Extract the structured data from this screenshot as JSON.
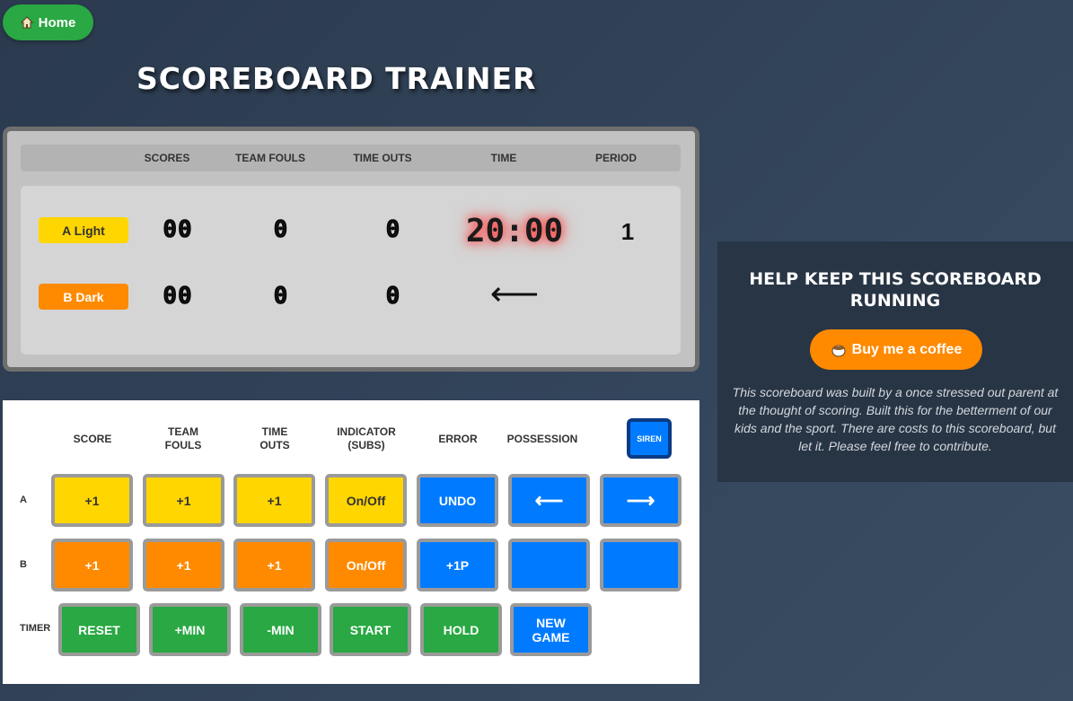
{
  "nav": {
    "home_label": "Home"
  },
  "title": "SCOREBOARD TRAINER",
  "scoreboard": {
    "headers": {
      "scores": "SCORES",
      "team_fouls": "TEAM FOULS",
      "time_outs": "TIME OUTS",
      "time": "TIME",
      "period": "PERIOD"
    },
    "team_a": {
      "name": "A Light",
      "score": "00",
      "fouls": "0",
      "timeouts": "0"
    },
    "team_b": {
      "name": "B Dark",
      "score": "00",
      "fouls": "0",
      "timeouts": "0"
    },
    "clock": "20:00",
    "period": "1",
    "possession_arrow": "⟵"
  },
  "controls": {
    "headers": {
      "score": "SCORE",
      "team_fouls": "TEAM\nFOULS",
      "time_outs": "TIME\nOUTS",
      "indicator": "INDICATOR\n(SUBS)",
      "error": "ERROR",
      "possession": "POSSESSION"
    },
    "siren_label": "SIREN",
    "row_labels": {
      "a": "A",
      "b": "B",
      "timer": "TIMER"
    },
    "row_a": {
      "score": "+1",
      "fouls": "+1",
      "timeouts": "+1",
      "indicator": "On/Off",
      "error": "UNDO",
      "poss_left": "⟵",
      "poss_right": "⟶"
    },
    "row_b": {
      "score": "+1",
      "fouls": "+1",
      "timeouts": "+1",
      "indicator": "On/Off",
      "error": "+1P"
    },
    "timer": {
      "reset": "RESET",
      "plus_min": "+MIN",
      "minus_min": "-MIN",
      "start": "START",
      "hold": "HOLD",
      "new_game": "NEW\nGAME"
    }
  },
  "support": {
    "title": "HELP KEEP THIS SCOREBOARD RUNNING",
    "button_label": "Buy me a coffee",
    "text": "This scoreboard was built by a once stressed out parent at the thought of scoring. Built this for the betterment of our kids and the sport. There are costs to this scoreboard, but let it. Please feel free to contribute."
  },
  "colors": {
    "yellow": "#ffd600",
    "orange": "#ff8a00",
    "blue": "#007bff",
    "green": "#29a843"
  }
}
